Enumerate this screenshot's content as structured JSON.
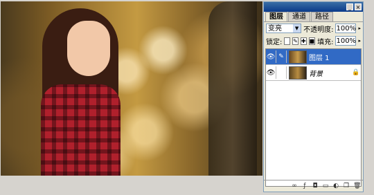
{
  "panel": {
    "title_buttons": [
      "_",
      "×"
    ],
    "tabs": [
      {
        "label": "图层",
        "active": true
      },
      {
        "label": "通道",
        "active": false
      },
      {
        "label": "路径",
        "active": false
      }
    ],
    "blend_mode": "变亮",
    "opacity_label": "不透明度:",
    "opacity_value": "100%",
    "lock_label": "锁定:",
    "fill_label": "填充:",
    "fill_value": "100%",
    "layers": [
      {
        "name": "图层 1",
        "visible": true,
        "selected": true,
        "locked": false
      },
      {
        "name": "背景",
        "visible": true,
        "selected": false,
        "locked": true
      }
    ],
    "bottom_icons": [
      "link-icon",
      "layer-style-icon",
      "mask-icon",
      "group-icon",
      "adjustment-icon",
      "new-layer-icon",
      "trash-icon"
    ]
  },
  "colors": {
    "selected_layer": "#316ac5",
    "titlebar": "#0a3a8a",
    "panel_bg": "#ece9d8"
  }
}
